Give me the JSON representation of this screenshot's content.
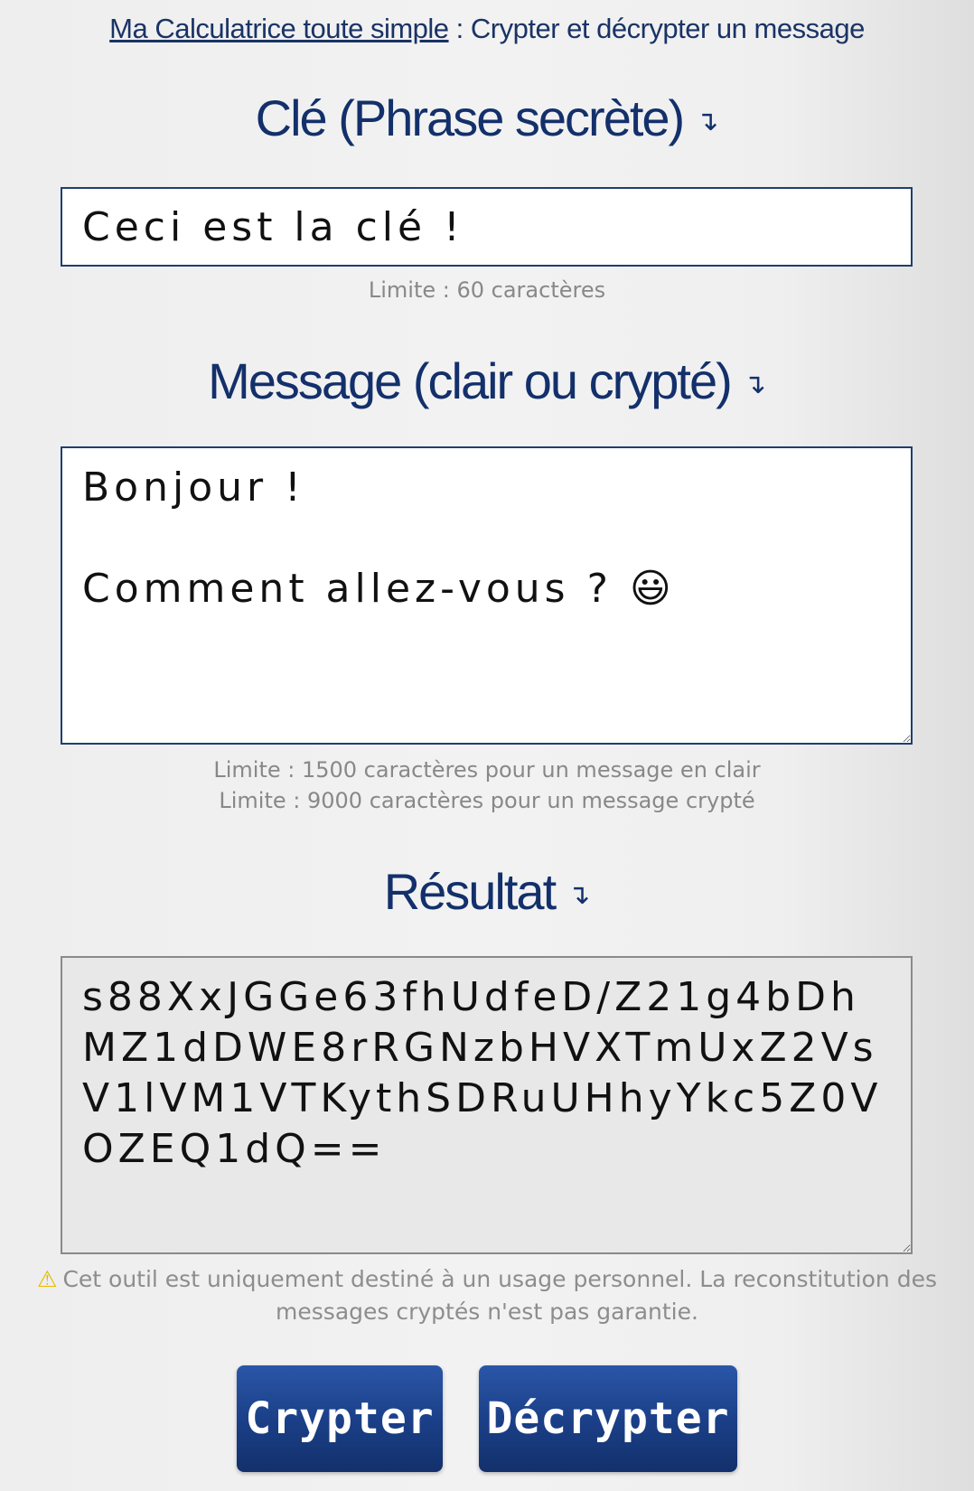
{
  "header": {
    "link_text": "Ma Calculatrice toute simple",
    "separator": " : ",
    "subtitle": "Crypter et décrypter un message"
  },
  "key_section": {
    "title": "Clé (Phrase secrète)",
    "arrow": "↴",
    "value": "Ceci est la clé !",
    "hint": "Limite : 60 caractères"
  },
  "message_section": {
    "title": "Message (clair ou crypté)",
    "arrow": "↴",
    "value": "Bonjour !\n\nComment allez-vous ? 😃",
    "hint_clear": "Limite : 1500 caractères pour un message en clair",
    "hint_crypted": "Limite : 9000 caractères pour un message crypté"
  },
  "result_section": {
    "title": "Résultat",
    "arrow": "↴",
    "value": "s88XxJGGe63fhUdfeD/Z21g4bDhMZ1dDWE8rRGNzbHVXTmUxZ2VsV1lVM1VTKythSDRuUHhyYkc5Z0VOZEQ1dQ=="
  },
  "warning": {
    "icon": "warning-icon",
    "text": "Cet outil est uniquement destiné à un usage personnel. La reconstitution des messages cryptés n'est pas garantie."
  },
  "buttons": {
    "encrypt": "Crypter",
    "decrypt": "Décrypter"
  },
  "colors": {
    "primary": "#13306b",
    "button_gradient_top": "#2a56a8",
    "hint": "#888888",
    "warning_icon": "#e6b800"
  }
}
